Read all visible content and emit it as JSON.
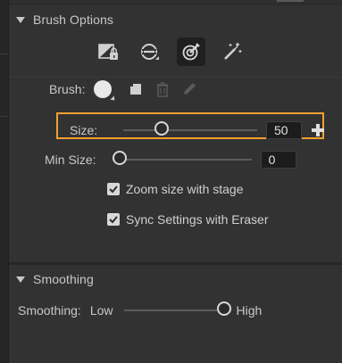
{
  "brush_options": {
    "title": "Brush Options",
    "tools": [
      {
        "name": "lock-fill-mode",
        "active": false
      },
      {
        "name": "brush-mode",
        "active": false
      },
      {
        "name": "pressure-target",
        "active": true
      },
      {
        "name": "magic-brush",
        "active": false
      }
    ],
    "brush_label": "Brush:",
    "size": {
      "label": "Size:",
      "value": "50",
      "slider_fraction": 0.26
    },
    "min_size": {
      "label": "Min Size:",
      "value": "0",
      "slider_fraction": 0.0
    },
    "zoom_with_stage": {
      "label": "Zoom size with stage",
      "checked": true
    },
    "sync_with_eraser": {
      "label": "Sync Settings with Eraser",
      "checked": true
    }
  },
  "smoothing": {
    "title": "Smoothing",
    "label": "Smoothing:",
    "low_label": "Low",
    "high_label": "High",
    "slider_fraction": 1.0
  },
  "colors": {
    "highlight": "#f0a030",
    "panel": "#323232",
    "text": "#c8c8c8"
  }
}
